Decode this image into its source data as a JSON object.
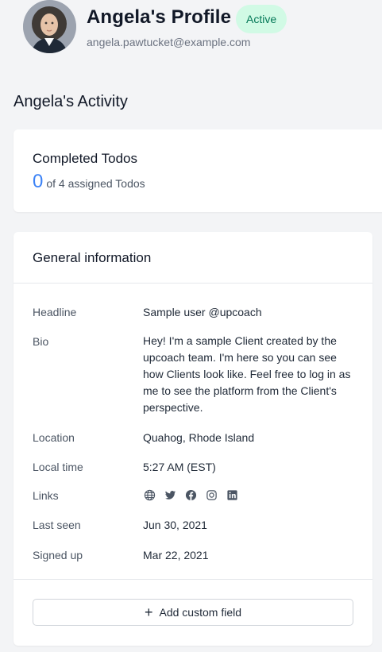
{
  "profile": {
    "name_title": "Angela's Profile",
    "status": "Active",
    "email": "angela.pawtucket@example.com",
    "avatar_icon": "user-avatar-photo"
  },
  "activity": {
    "heading": "Angela's Activity"
  },
  "todos": {
    "title": "Completed Todos",
    "completed": "0",
    "assigned_text": "of 4 assigned Todos"
  },
  "general": {
    "title": "General information",
    "rows": {
      "headline": {
        "label": "Headline",
        "value": "Sample user @upcoach"
      },
      "bio": {
        "label": "Bio",
        "value": "Hey! I'm a sample Client created by the upcoach team. I'm here so you can see how Clients look like. Feel free to log in as me to see the platform from the Client's perspective."
      },
      "location": {
        "label": "Location",
        "value": "Quahog, Rhode Island"
      },
      "local_time": {
        "label": "Local time",
        "value": "5:27 AM (EST)"
      },
      "links": {
        "label": "Links",
        "icons": [
          "globe-icon",
          "twitter-icon",
          "facebook-icon",
          "instagram-icon",
          "linkedin-icon"
        ]
      },
      "last_seen": {
        "label": "Last seen",
        "value": "Jun 30, 2021"
      },
      "signed_up": {
        "label": "Signed up",
        "value": "Mar 22, 2021"
      }
    },
    "add_field_label": "Add custom field"
  },
  "colors": {
    "accent": "#3b82f6",
    "badge_bg": "#d1fae5",
    "badge_text": "#047857",
    "background": "#f3f4f6"
  }
}
